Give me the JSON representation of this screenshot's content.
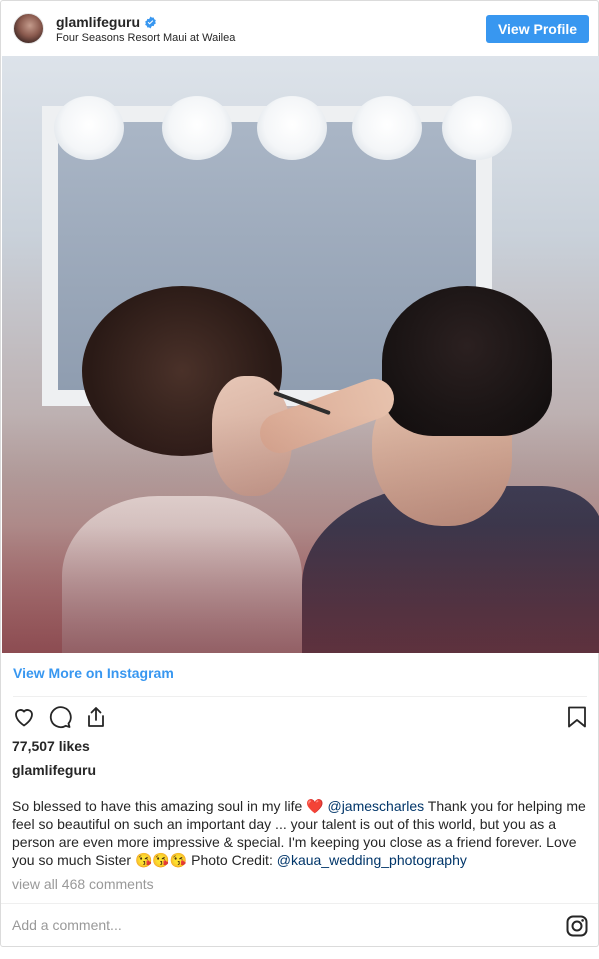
{
  "header": {
    "username": "glamlifeguru",
    "location": "Four Seasons Resort Maui at Wailea",
    "view_profile_label": "View Profile",
    "verified": true
  },
  "post": {
    "view_more_label": "View More on Instagram",
    "likes": "77,507 likes",
    "caption_username": "glamlifeguru",
    "caption": {
      "part1": "So blessed to have this amazing soul in my life ❤️ ",
      "mention1": "@jamescharles",
      "part2": " Thank you for helping me feel so beautiful on such an important day ... your talent is out of this world, but you as a person are even more impressive & special. I'm keeping you close as a friend forever. Love you so much Sister 😘😘😘 Photo Credit: ",
      "mention2": "@kaua_wedding_photography"
    },
    "comments_link": "view all 468 comments",
    "add_comment_placeholder": "Add a comment..."
  },
  "icons": [
    "heart-icon",
    "comment-icon",
    "share-icon",
    "bookmark-icon",
    "instagram-icon",
    "verified-badge-icon"
  ],
  "colors": {
    "accent": "#3897f0",
    "mention": "#003569",
    "muted": "#999999",
    "text": "#262626",
    "border": "#dbdbdb"
  }
}
